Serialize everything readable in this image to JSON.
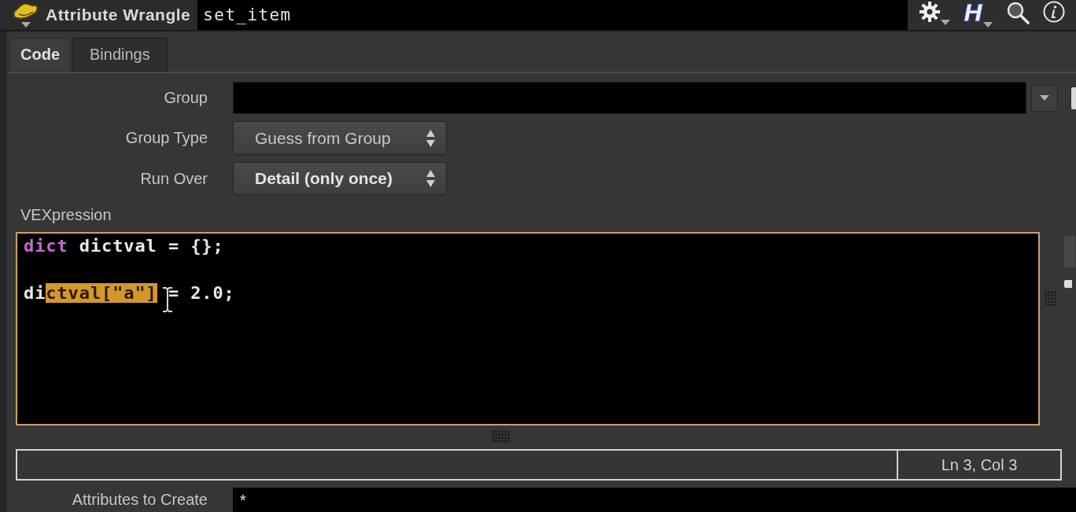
{
  "header": {
    "node_type": "Attribute Wrangle",
    "node_name": "set_item",
    "help_label": "H"
  },
  "tabs": [
    {
      "label": "Code",
      "selected": true
    },
    {
      "label": "Bindings",
      "selected": false
    }
  ],
  "parameters": [
    {
      "label": "Group",
      "kind": "text"
    },
    {
      "label": "Group Type",
      "kind": "menu",
      "value": "Guess from Group",
      "modified": false
    },
    {
      "label": "Run Over",
      "kind": "menu",
      "value": "Detail (only once)",
      "modified": true
    }
  ],
  "vexpression": {
    "label": "VEXpression",
    "lines": [
      {
        "kind": "code",
        "segments": [
          {
            "text": "dict",
            "kind": "keyword"
          },
          {
            "text": " dictval = {};",
            "kind": "plain"
          }
        ]
      },
      {
        "kind": "blank"
      },
      {
        "kind": "code",
        "segments": [
          {
            "text": "di",
            "kind": "plain"
          },
          {
            "text": "ctval[\"a\"]",
            "kind": "selected"
          },
          {
            "text": " = 2.0;",
            "kind": "plain"
          }
        ]
      }
    ]
  },
  "status_bar": {
    "position": "Ln 3, Col 3"
  },
  "attributes_to_create": {
    "label": "Attributes to Create",
    "value": "*"
  }
}
